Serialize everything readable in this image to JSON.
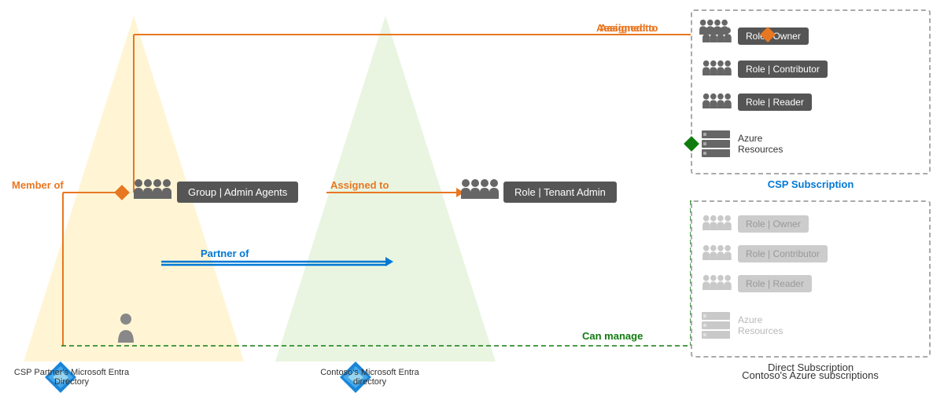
{
  "triangles": {
    "left_label": "CSP Partner's Microsoft Entra Directory",
    "right_label": "Contoso's Microsoft Entra directory"
  },
  "labels": {
    "member_of": "Member of",
    "partner_of": "Partner of",
    "assigned_to_1": "Assigned to",
    "assigned_to_2": "Assigned to",
    "can_manage": "Can manage"
  },
  "groups": {
    "admin_agents": "Group | Admin Agents",
    "tenant_admin": "Role | Tenant Admin"
  },
  "csp_subscription": {
    "title": "CSP Subscription",
    "roles": [
      "Role | Owner",
      "Role | Contributor",
      "Role | Reader"
    ],
    "resources_label": "Azure\nResources"
  },
  "direct_subscription": {
    "title": "Direct Subscription",
    "roles": [
      "Role | Owner",
      "Role | Contributor",
      "Role | Reader"
    ],
    "resources_label": "Azure\nResources"
  },
  "bottom_caption": "Contoso's Azure subscriptions"
}
